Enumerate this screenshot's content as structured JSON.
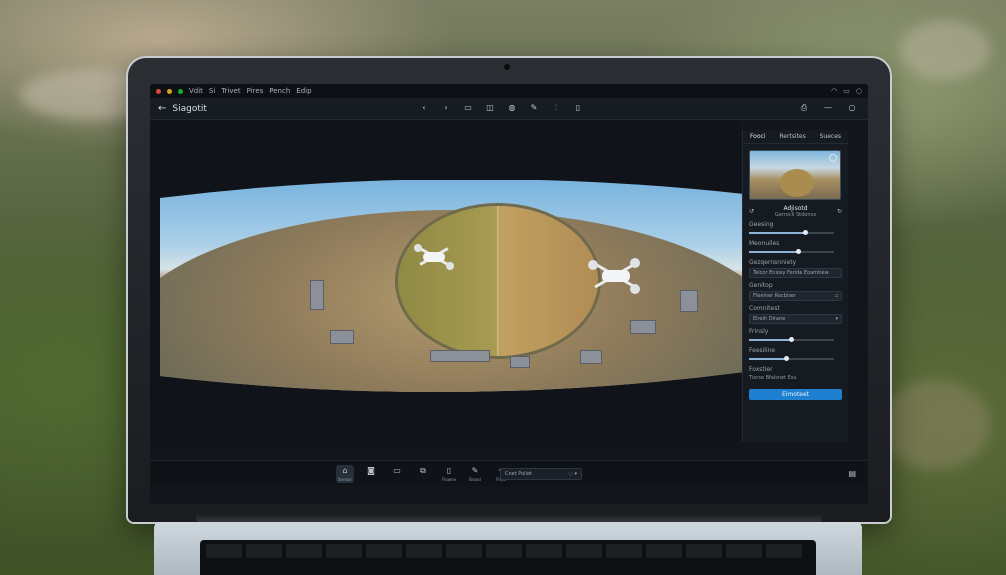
{
  "menubar": {
    "items": [
      "Vdit",
      "Si",
      "Trivet",
      "Pires",
      "Pench",
      "Edip"
    ]
  },
  "header": {
    "back_icon": "arrow-left-icon",
    "title": "Siagotit",
    "toolbar_icons": [
      "undo-icon",
      "redo-icon",
      "crop-icon",
      "compare-icon",
      "globe-icon",
      "brush-icon",
      "adjust-icon",
      "export-icon"
    ]
  },
  "panel": {
    "tabs": [
      "Fooci",
      "Rertsites",
      "Sueces"
    ],
    "thumb_caption": "Adjisotd",
    "thumb_sub": "Gerrocli Stdonvs",
    "sections": [
      {
        "label": "Geesing",
        "value": 0.7
      },
      {
        "label": "Meonuiles",
        "value": 0.6
      }
    ],
    "fields": [
      {
        "label": "Gezqernsnniety",
        "value": "Teicor Eniosy Feride Eoamtiew"
      },
      {
        "label": "Genitop",
        "value": "Fleeiner Rocbiser"
      },
      {
        "label": "Comnitest",
        "value": "Elreih Dirane"
      }
    ],
    "sliders2": [
      {
        "label": "Frinsly",
        "value": 0.5
      },
      {
        "label": "Feesiline",
        "value": 0.45
      }
    ],
    "footer_label": "Foxstier",
    "footer_value": "Tixrse Bfalsnet Esu",
    "apply_label": "Eimoteet"
  },
  "dock": {
    "items": [
      {
        "icon": "home-icon",
        "caption": "Sonoor"
      },
      {
        "icon": "camera-icon",
        "caption": ""
      },
      {
        "icon": "video-icon",
        "caption": ""
      },
      {
        "icon": "copy-icon",
        "caption": ""
      },
      {
        "icon": "doc-icon",
        "caption": "Flowne"
      },
      {
        "icon": "pen-icon",
        "caption": "Brovd"
      },
      {
        "icon": "shape-icon",
        "caption": "Flete"
      }
    ],
    "select_value": "Cnet Poliet"
  }
}
